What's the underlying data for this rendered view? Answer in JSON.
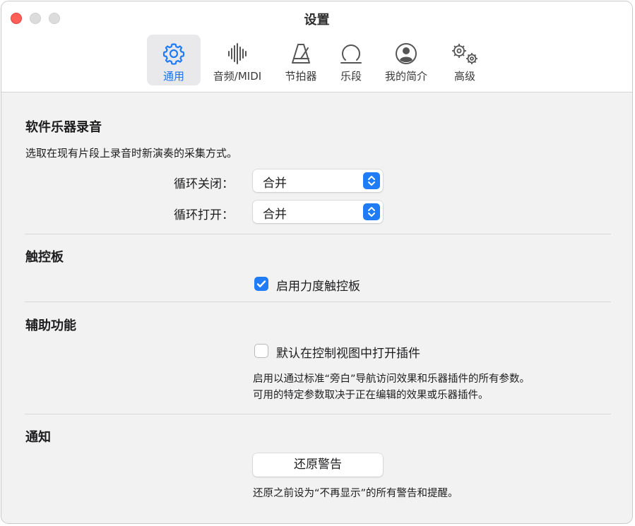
{
  "window": {
    "title": "设置"
  },
  "tabs": [
    {
      "label": "通用",
      "icon": "gear-icon",
      "active": true
    },
    {
      "label": "音频/MIDI",
      "icon": "waveform-icon",
      "active": false
    },
    {
      "label": "节拍器",
      "icon": "metronome-icon",
      "active": false
    },
    {
      "label": "乐段",
      "icon": "region-icon",
      "active": false
    },
    {
      "label": "我的简介",
      "icon": "person-circle-icon",
      "active": false
    },
    {
      "label": "高级",
      "icon": "gears-icon",
      "active": false
    }
  ],
  "software_recording": {
    "title": "软件乐器录音",
    "description": "选取在现有片段上录音时新演奏的采集方式。",
    "cycle_off_label": "循环关闭：",
    "cycle_off_value": "合并",
    "cycle_on_label": "循环打开：",
    "cycle_on_value": "合并"
  },
  "trackpad": {
    "title": "触控板",
    "force_touch_label": "启用力度触控板",
    "force_touch_checked": true
  },
  "accessibility": {
    "title": "辅助功能",
    "open_plugins_label": "默认在控制视图中打开插件",
    "open_plugins_checked": false,
    "description_line1": "启用以通过标准“旁白”导航访问效果和乐器插件的所有参数。",
    "description_line2": "可用的特定参数取决于正在编辑的效果或乐器插件。"
  },
  "notifications": {
    "title": "通知",
    "reset_button": "还原警告",
    "description": "还原之前设为“不再显示”的所有警告和提醒。"
  },
  "colors": {
    "accent": "#1f7cf6",
    "close": "#ff5f57"
  }
}
